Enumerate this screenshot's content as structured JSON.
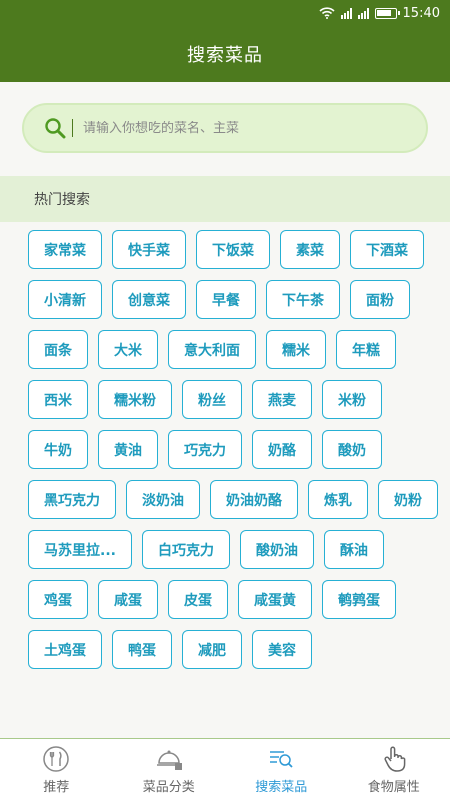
{
  "status": {
    "time": "15:40",
    "battery_level": 0.85
  },
  "header": {
    "title": "搜索菜品"
  },
  "search": {
    "placeholder": "请输入你想吃的菜名、主菜"
  },
  "hot": {
    "title": "热门搜索",
    "tags": [
      "家常菜",
      "快手菜",
      "下饭菜",
      "素菜",
      "下酒菜",
      "小清新",
      "创意菜",
      "早餐",
      "下午茶",
      "面粉",
      "面条",
      "大米",
      "意大利面",
      "糯米",
      "年糕",
      "西米",
      "糯米粉",
      "粉丝",
      "燕麦",
      "米粉",
      "牛奶",
      "黄油",
      "巧克力",
      "奶酪",
      "酸奶",
      "黑巧克力",
      "淡奶油",
      "奶油奶酪",
      "炼乳",
      "奶粉",
      "马苏里拉...",
      "白巧克力",
      "酸奶油",
      "酥油",
      "鸡蛋",
      "咸蛋",
      "皮蛋",
      "咸蛋黄",
      "鹌鹑蛋",
      "土鸡蛋",
      "鸭蛋",
      "减肥",
      "美容"
    ]
  },
  "tabs": [
    {
      "label": "推荐",
      "icon": "fork-knife-icon"
    },
    {
      "label": "菜品分类",
      "icon": "cloche-icon"
    },
    {
      "label": "搜索菜品",
      "icon": "search-list-icon",
      "active": true
    },
    {
      "label": "食物属性",
      "icon": "hand-pointer-icon"
    }
  ],
  "colors": {
    "brand": "#4d7a1e",
    "tag": "#26b0d4",
    "active_tab": "#2f9ad6"
  }
}
